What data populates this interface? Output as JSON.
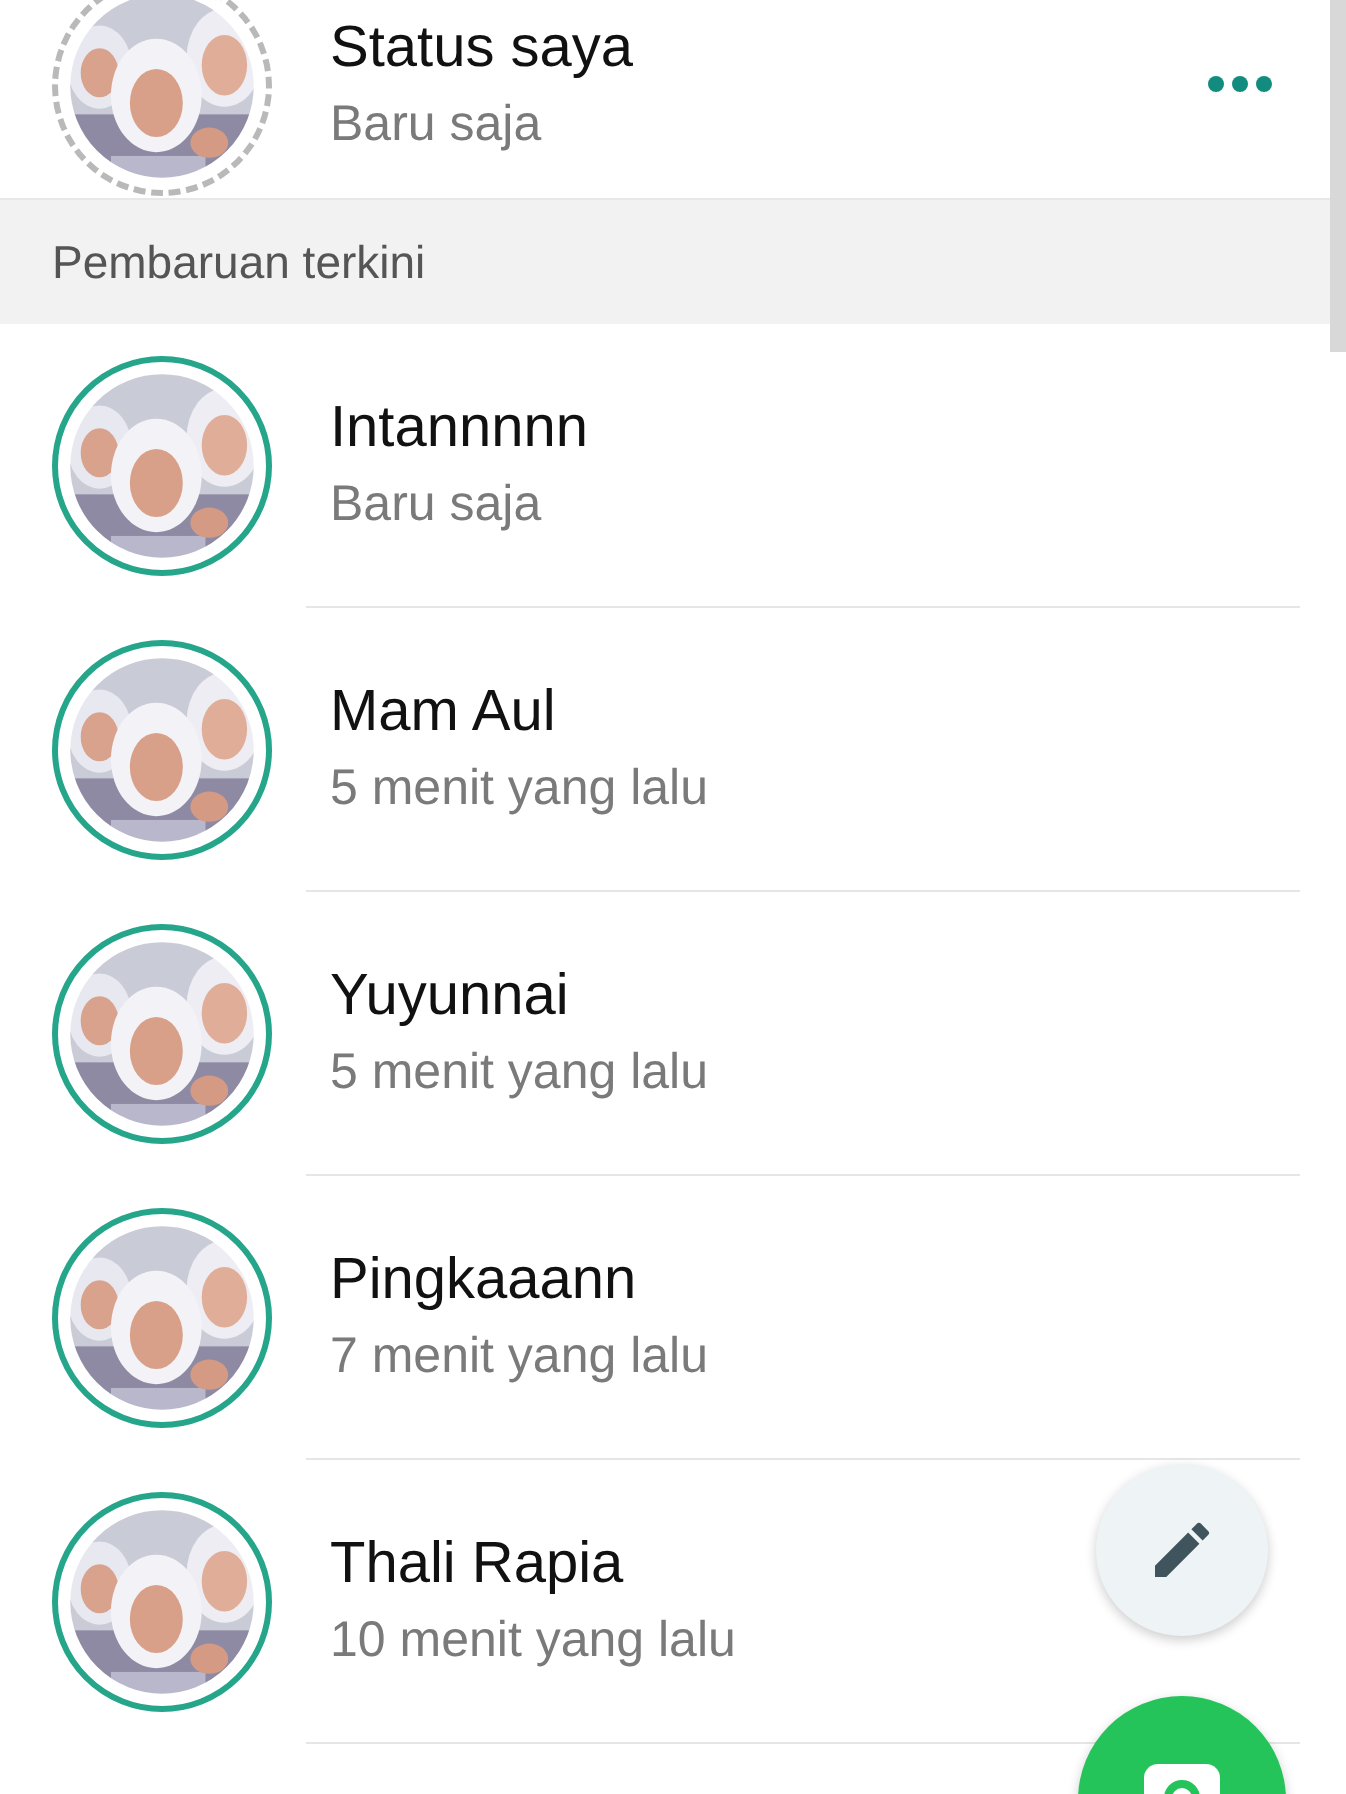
{
  "my_status": {
    "name": "Status saya",
    "time": "Baru saja",
    "viewed": true
  },
  "section_header": "Pembaruan terkini",
  "updates": [
    {
      "name": "Intannnnn",
      "time": "Baru saja",
      "viewed": false
    },
    {
      "name": "Mam Aul",
      "time": "5 menit yang lalu",
      "viewed": false
    },
    {
      "name": "Yuyunnai",
      "time": "5 menit yang lalu",
      "viewed": false
    },
    {
      "name": "Pingkaaann",
      "time": "7 menit yang lalu",
      "viewed": false
    },
    {
      "name": "Thali Rapia",
      "time": "10 menit yang lalu",
      "viewed": false
    }
  ]
}
